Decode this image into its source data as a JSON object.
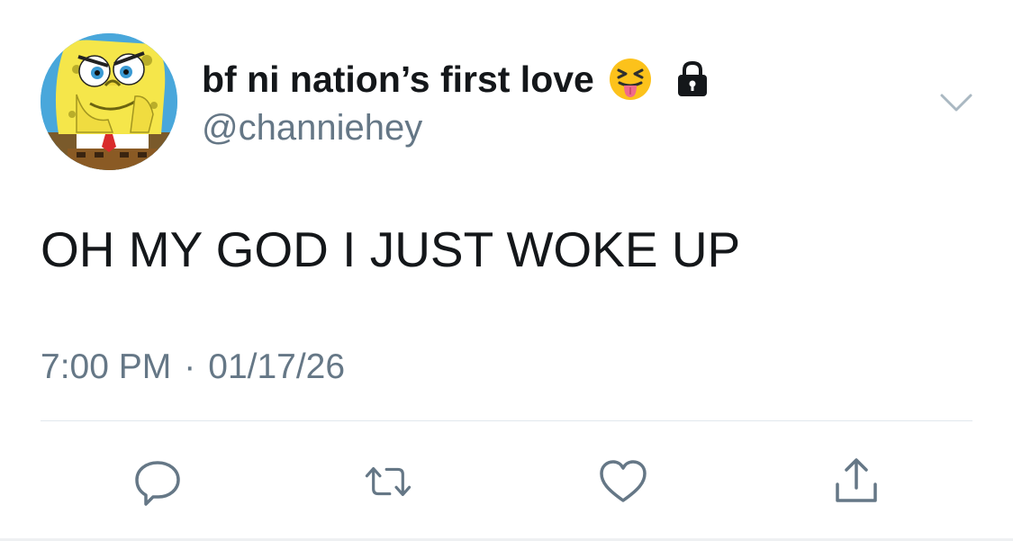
{
  "tweet": {
    "display_name": "bf ni nation’s first love",
    "handle": "@channiehey",
    "text": "OH MY GOD I JUST WOKE UP",
    "time": "7:00 PM",
    "separator": "·",
    "date": "01/17/26"
  },
  "icons": {
    "avatar": "spongebob-avatar",
    "name_emoji": "squinting-face-with-tongue-icon",
    "protected": "lock-icon",
    "menu": "chevron-down-icon",
    "actions": [
      "reply-icon",
      "retweet-icon",
      "like-icon",
      "share-icon"
    ]
  },
  "colors": {
    "text": "#14171a",
    "secondary": "#657786",
    "icon": "#657786",
    "divider": "#e1e8ed"
  }
}
